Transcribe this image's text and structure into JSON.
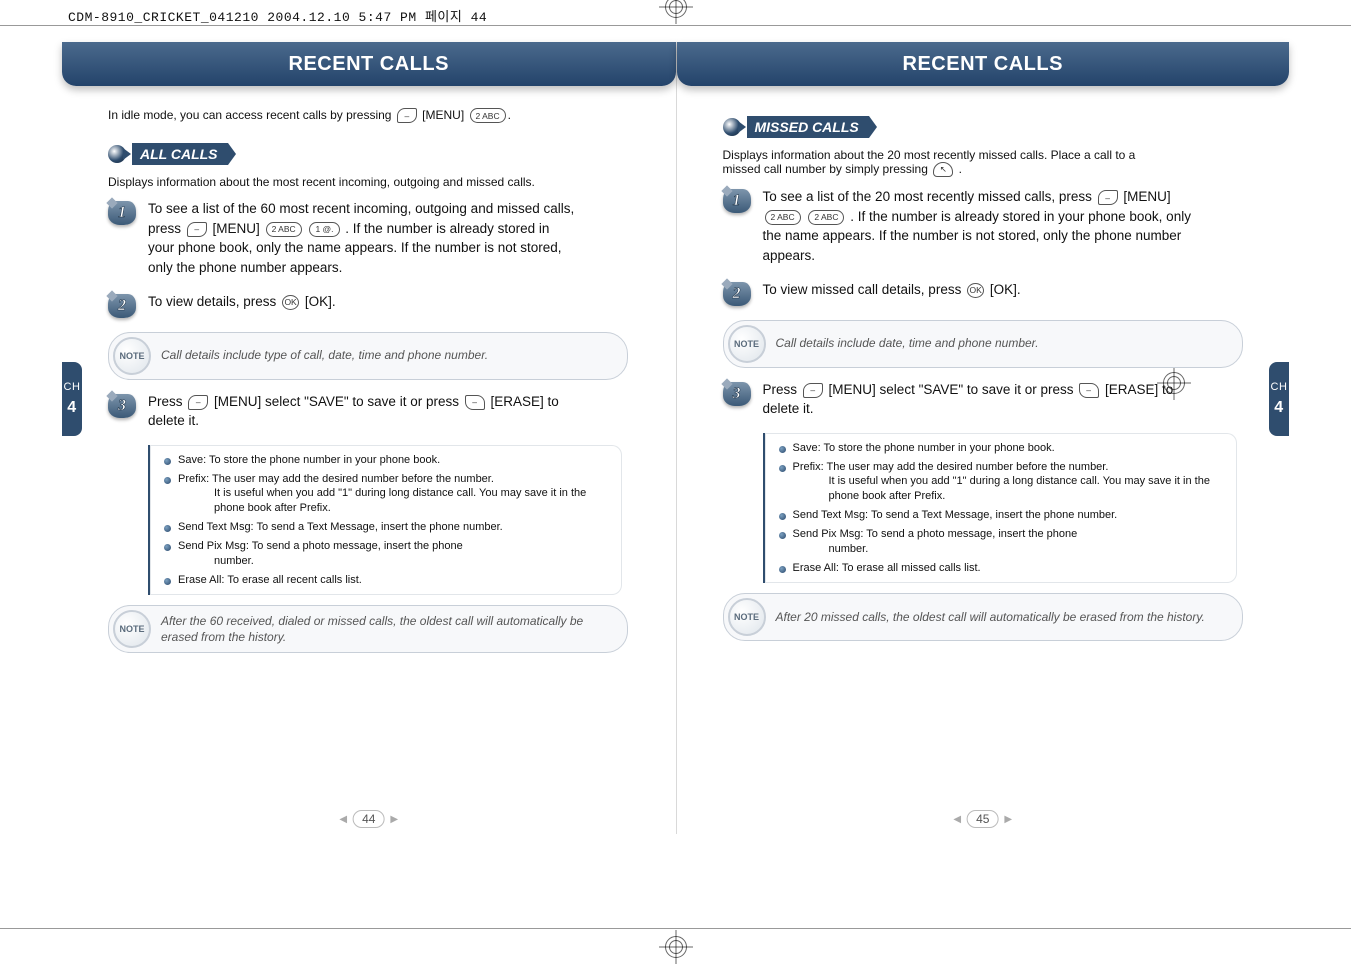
{
  "prepress_header": "CDM-8910_CRICKET_041210  2004.12.10 5:47 PM  페이지 44",
  "chapter_tab": {
    "left": {
      "ch": "CH",
      "num": "4"
    },
    "right": {
      "ch": "CH",
      "num": "4"
    }
  },
  "left_page": {
    "title": "RECENT CALLS",
    "intro": "In idle mode, you can access recent calls by pressing",
    "intro_tail": "[MENU]",
    "intro_tail2": ".",
    "section": {
      "heading": "ALL CALLS",
      "desc": "Displays information about the most recent incoming, outgoing and missed calls.",
      "steps": [
        {
          "n": "1",
          "text_a": "To see a list of the 60 most recent incoming, outgoing and missed calls, press",
          "text_b": "[MENU]",
          "text_c": ". If the number is already stored in your phone book, only the name appears. If the number is not stored, only the phone number appears."
        },
        {
          "n": "2",
          "text_a": "To view details, press",
          "text_b": "[OK].",
          "text_c": ""
        },
        {
          "n": "3",
          "text_a": "Press",
          "text_b": "[MENU] select \"SAVE\" to save it or press",
          "text_c": "[ERASE] to delete it."
        }
      ],
      "notes": [
        "Call details include type of call, date, time and phone number.",
        "After the 60 received, dialed or missed calls, the oldest call will automatically be erased from the history."
      ],
      "bullets": [
        {
          "main": "Save: To store the phone number in your phone book."
        },
        {
          "main": "Prefix: The user may add the desired number before the number.",
          "sub": "It is useful when you add \"1\" during long distance call. You may save it in the phone book after Prefix."
        },
        {
          "main": "Send Text Msg: To send a Text Message, insert the phone number."
        },
        {
          "main": "Send Pix Msg: To send a photo message, insert the phone",
          "sub": "number."
        },
        {
          "main": "Erase All: To erase all recent calls list."
        }
      ]
    },
    "page_number": "44"
  },
  "right_page": {
    "title": "RECENT CALLS",
    "section": {
      "heading": "MISSED CALLS",
      "desc_a": "Displays information about the 20 most recently missed calls. Place a call to a missed call number by simply pressing",
      "desc_b": ".",
      "steps": [
        {
          "n": "1",
          "text_a": "To see a list of the 20 most recently missed calls, press",
          "text_b": "[MENU]",
          "text_c": ". If the number is already stored in your phone book, only the name appears. If the number is not stored, only the phone number appears."
        },
        {
          "n": "2",
          "text_a": "To view missed call details, press",
          "text_b": "[OK].",
          "text_c": ""
        },
        {
          "n": "3",
          "text_a": "Press",
          "text_b": "[MENU] select \"SAVE\" to save it or press",
          "text_c": "[ERASE] to delete it."
        }
      ],
      "notes": [
        "Call details include date, time and phone number.",
        "After 20 missed calls, the oldest call will automatically be erased from the history."
      ],
      "bullets": [
        {
          "main": "Save: To store the phone number in your phone book."
        },
        {
          "main": "Prefix: The user may add the desired number before the number.",
          "sub": "It is useful when you add \"1\" during a long distance call. You may save it in the phone book after Prefix."
        },
        {
          "main": "Send Text Msg: To send a Text Message, insert the phone number."
        },
        {
          "main": "Send Pix Msg: To send a photo message, insert the phone",
          "sub": "number."
        },
        {
          "main": "Erase All: To erase all missed calls list."
        }
      ]
    },
    "page_number": "45"
  },
  "key_labels": {
    "menu_soft": "–",
    "erase_soft": "–",
    "two": "2 ABC",
    "one": "1 @.",
    "ok": "OK",
    "send": "↖"
  },
  "note_badge": "NOTE"
}
